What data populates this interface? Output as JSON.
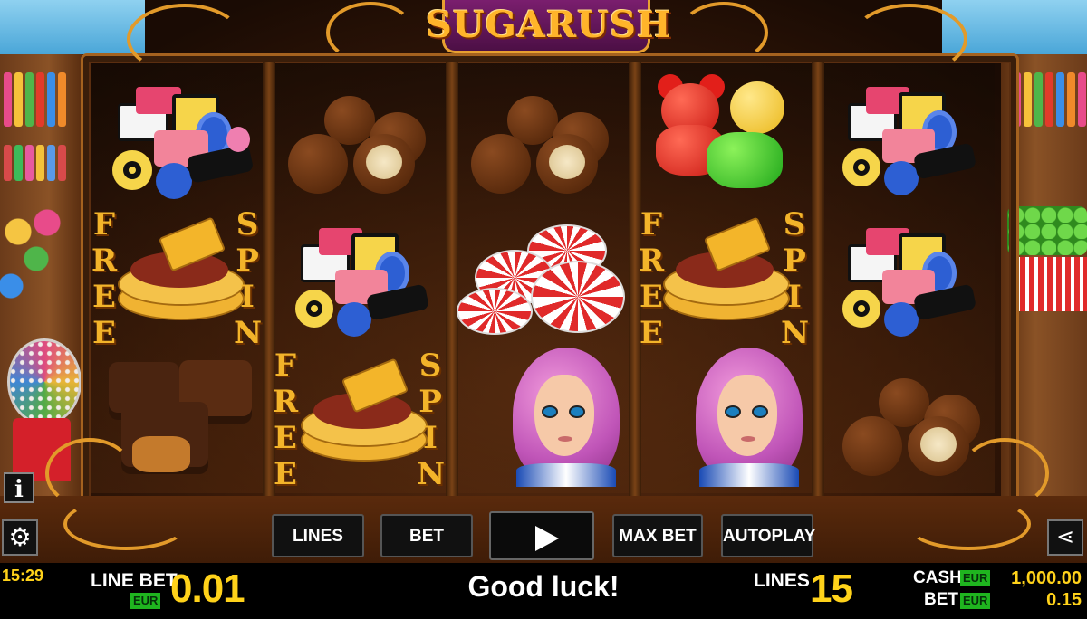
{
  "logo": {
    "text": "SUGARUSH"
  },
  "reels": {
    "free_spin_word1": [
      "F",
      "R",
      "E",
      "E"
    ],
    "free_spin_word2": [
      "S",
      "P",
      "I",
      "N"
    ],
    "symbols": [
      [
        "liquorice-allsorts",
        "free-spin-pie",
        "chocolate-caramel-cups"
      ],
      [
        "chocolate-truffles",
        "liquorice-allsorts",
        "free-spin-pie"
      ],
      [
        "chocolate-truffles",
        "peppermint-candies",
        "pink-haired-girl"
      ],
      [
        "gummy-bears",
        "free-spin-pie",
        "pink-haired-girl"
      ],
      [
        "liquorice-allsorts",
        "liquorice-allsorts",
        "chocolate-truffles"
      ]
    ]
  },
  "controls": {
    "info_label": "i",
    "lines_label": "LINES",
    "bet_level_label": "BET LEVEL",
    "max_bet_label": "MAX BET",
    "autoplay_label": "AUTOPLAY"
  },
  "status": {
    "time": "15:29",
    "line_bet_label": "LINE BET",
    "currency": "EUR",
    "line_bet_value": "0.01",
    "message": "Good luck!",
    "lines_label": "LINES",
    "lines_value": "15",
    "cash_label": "CASH",
    "cash_value": "1,000.00",
    "bet_label": "BET",
    "bet_value": "0.15"
  },
  "colors": {
    "accent": "#ffd21a",
    "currency_badge": "#1fb51f",
    "logo": "#ffb42a"
  }
}
